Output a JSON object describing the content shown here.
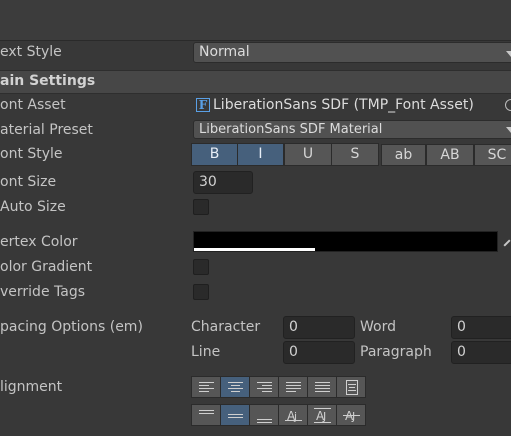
{
  "rows": {
    "text_style": "ext Style",
    "main_settings": "ain Settings",
    "font_asset": "ont Asset",
    "material_preset": "aterial Preset",
    "font_style": "ont Style",
    "font_size": "ont Size",
    "auto_size": " Auto Size",
    "vertex_color": "ertex Color",
    "color_gradient": "olor Gradient",
    "override_tags": "verride Tags",
    "spacing_options": "pacing Options (em)",
    "alignment": "lignment"
  },
  "text_style_value": "Normal",
  "font_asset": {
    "icon": "F",
    "value": "LiberationSans SDF (TMP_Font Asset)"
  },
  "material_preset_value": "LiberationSans SDF Material",
  "font_style_buttons": [
    {
      "label": "B",
      "active": true
    },
    {
      "label": "I",
      "active": true
    },
    {
      "label": "U",
      "active": false
    },
    {
      "label": "S",
      "active": false
    },
    {
      "label": "ab",
      "active": false
    },
    {
      "label": "AB",
      "active": false
    },
    {
      "label": "SC",
      "active": false
    }
  ],
  "font_size_value": "30",
  "auto_size_checked": false,
  "vertex_color": {
    "rgb": "#000000",
    "alpha": 0.8
  },
  "color_gradient_checked": false,
  "override_tags_checked": false,
  "spacing": {
    "character_label": "Character",
    "character_value": "0",
    "word_label": "Word",
    "word_value": "0",
    "line_label": "Line",
    "line_value": "0",
    "paragraph_label": "Paragraph",
    "paragraph_value": "0"
  },
  "alignment_horizontal": [
    {
      "icon": "align-left-icon",
      "active": false
    },
    {
      "icon": "align-center-icon",
      "active": true
    },
    {
      "icon": "align-right-icon",
      "active": false
    },
    {
      "icon": "align-justified-icon",
      "active": false
    },
    {
      "icon": "align-flush-icon",
      "active": false
    },
    {
      "icon": "align-geometry-center-icon",
      "active": false
    }
  ],
  "alignment_vertical": [
    {
      "icon": "align-top-icon",
      "active": false
    },
    {
      "icon": "align-middle-icon",
      "active": true
    },
    {
      "icon": "align-bottom-icon",
      "active": false
    },
    {
      "icon": "align-baseline-icon",
      "active": false
    },
    {
      "icon": "align-midline-icon",
      "active": false
    },
    {
      "icon": "align-capline-icon",
      "active": false
    }
  ],
  "colors": {
    "accent_active": "#46607c",
    "background": "#383838"
  }
}
